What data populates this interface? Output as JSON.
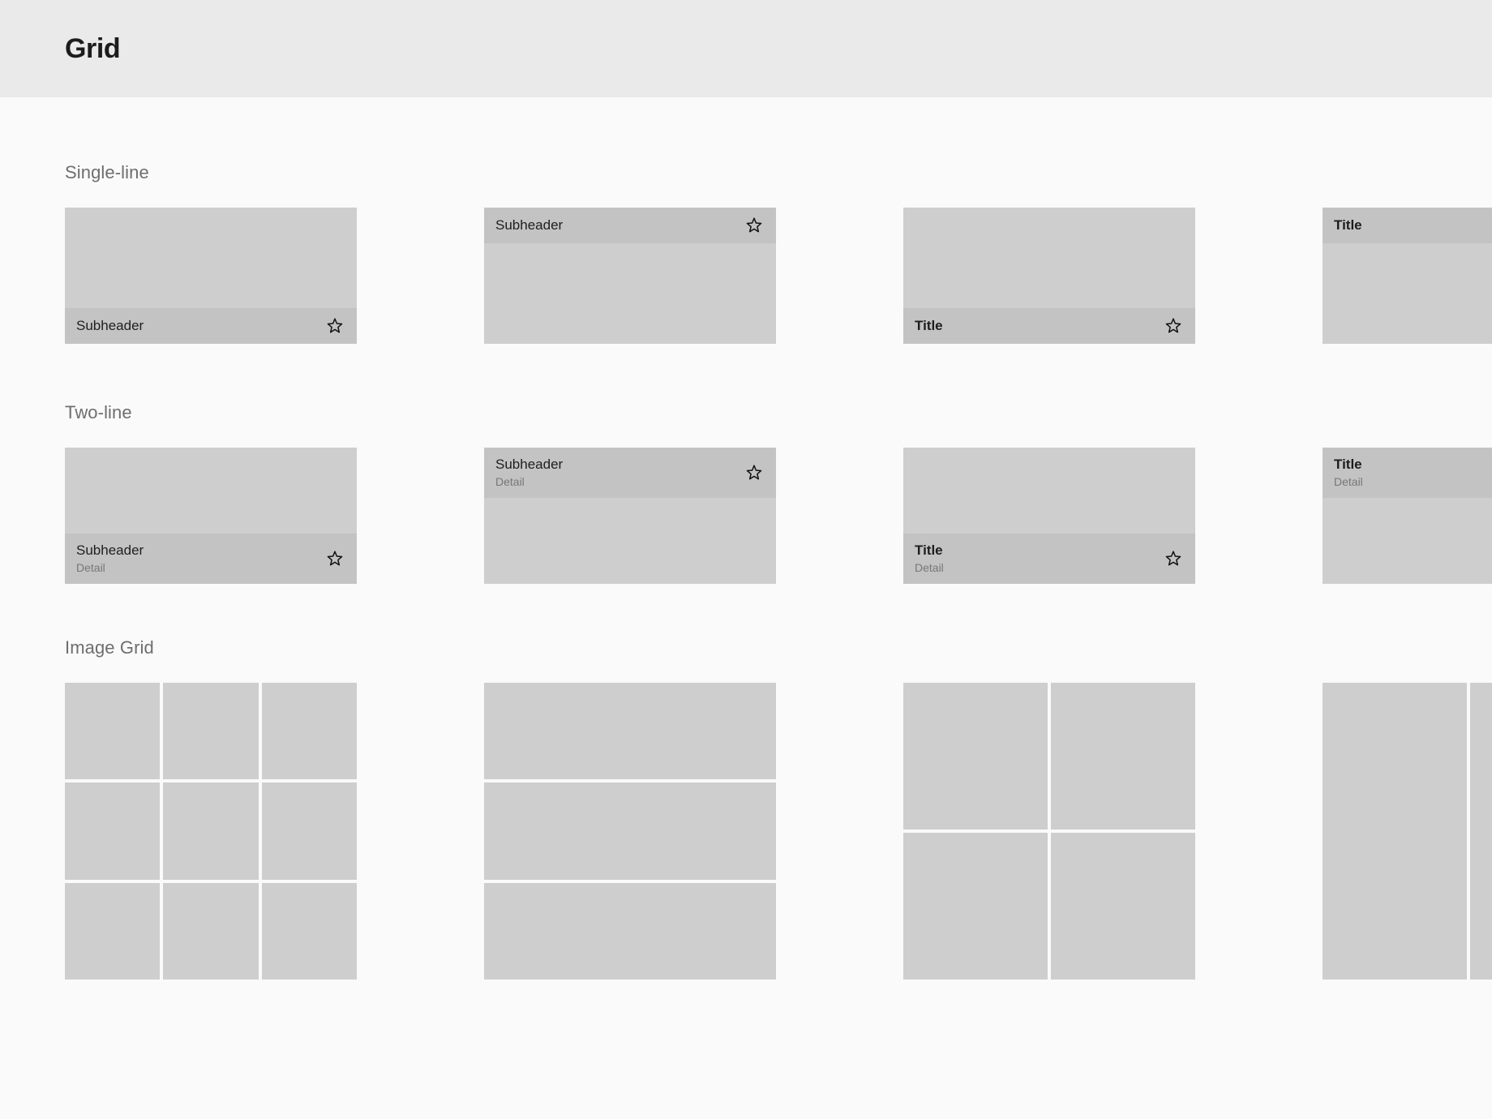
{
  "header": {
    "title": "Grid"
  },
  "colors": {
    "header_bg": "#eaeaea",
    "page_bg": "#fafafa",
    "card_bg": "#cecece",
    "bar_bg": "#c3c3c3",
    "primary_text": "#1e1e1e",
    "secondary_text": "#777777",
    "section_label": "#6e6e6e"
  },
  "sections": [
    {
      "label": "Single-line",
      "cards": [
        {
          "primary": "Subheader",
          "weight": "subheader",
          "bar_position": "bottom",
          "lines": 1,
          "icon": "star-outline-icon"
        },
        {
          "primary": "Subheader",
          "weight": "subheader",
          "bar_position": "top",
          "lines": 1,
          "icon": "star-outline-icon"
        },
        {
          "primary": "Title",
          "weight": "title",
          "bar_position": "bottom",
          "lines": 1,
          "icon": "star-outline-icon"
        },
        {
          "primary": "Title",
          "weight": "title",
          "bar_position": "top",
          "lines": 1,
          "icon": "star-outline-icon"
        }
      ]
    },
    {
      "label": "Two-line",
      "cards": [
        {
          "primary": "Subheader",
          "secondary": "Detail",
          "weight": "subheader",
          "bar_position": "bottom",
          "lines": 2,
          "icon": "star-outline-icon"
        },
        {
          "primary": "Subheader",
          "secondary": "Detail",
          "weight": "subheader",
          "bar_position": "top",
          "lines": 2,
          "icon": "star-outline-icon"
        },
        {
          "primary": "Title",
          "secondary": "Detail",
          "weight": "title",
          "bar_position": "bottom",
          "lines": 2,
          "icon": "star-outline-icon"
        },
        {
          "primary": "Title",
          "secondary": "Detail",
          "weight": "title",
          "bar_position": "top",
          "lines": 2,
          "icon": "star-outline-icon"
        }
      ]
    },
    {
      "label": "Image Grid",
      "grids": [
        {
          "layout": "3x3",
          "columns": 3,
          "rows": 3,
          "cells": 9
        },
        {
          "layout": "1x3",
          "columns": 1,
          "rows": 3,
          "cells": 3
        },
        {
          "layout": "2x2",
          "columns": 2,
          "rows": 2,
          "cells": 4
        },
        {
          "layout": "2x1",
          "columns": 2,
          "rows": 1,
          "cells": 2
        }
      ]
    }
  ]
}
